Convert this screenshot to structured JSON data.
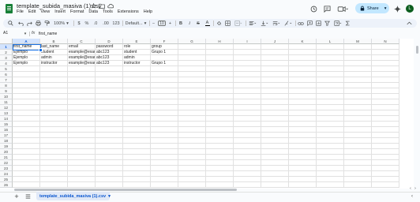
{
  "app": {
    "doc_title": "template_subida_masiva (1).csv",
    "avatar_letter": "L",
    "brand_color": "#188038",
    "accent_color": "#1a73e8"
  },
  "menu": [
    "File",
    "Edit",
    "View",
    "Insert",
    "Format",
    "Data",
    "Tools",
    "Extensions",
    "Help"
  ],
  "header_actions": {
    "share_label": "Share"
  },
  "toolbar": {
    "zoom": "100%",
    "currency": "$",
    "percent": "%",
    "decimals_decrease": ".0",
    "decimals_increase": ".00",
    "number_format": "123",
    "font_family": "Default...",
    "font_size": "10",
    "minus": "−",
    "plus": "+",
    "bold": "B",
    "italic": "I",
    "strike": "S",
    "text_color": "A"
  },
  "formula_bar": {
    "name_box": "A1",
    "fx_label": "fx",
    "value": "first_name"
  },
  "sheet": {
    "columns": [
      "A",
      "B",
      "C",
      "D",
      "E",
      "F",
      "G",
      "H",
      "I",
      "J",
      "K",
      "L",
      "M",
      "N"
    ],
    "row_numbers": [
      "1",
      "2",
      "3",
      "4",
      "5",
      "6",
      "7",
      "8",
      "9",
      "10",
      "11",
      "12",
      "13",
      "14",
      "15",
      "16",
      "17",
      "18",
      "19",
      "20",
      "21",
      "22",
      "23",
      "24",
      "25",
      "26"
    ],
    "selected_cell": "A1",
    "rows": [
      [
        "first_name",
        "last_name",
        "email",
        "password",
        "role",
        "group"
      ],
      [
        "Ejemplo",
        "student",
        "example@exam",
        "abc123",
        "student",
        "Grupo 1"
      ],
      [
        "Ejemplo",
        "admin",
        "example@exam",
        "abc123",
        "admin",
        ""
      ],
      [
        "Ejemplo",
        "instructor",
        "example@exam",
        "abc123",
        "instructor",
        "Grupo 1"
      ]
    ]
  },
  "tabs": {
    "active_sheet": "template_subida_masiva (1).csv"
  }
}
